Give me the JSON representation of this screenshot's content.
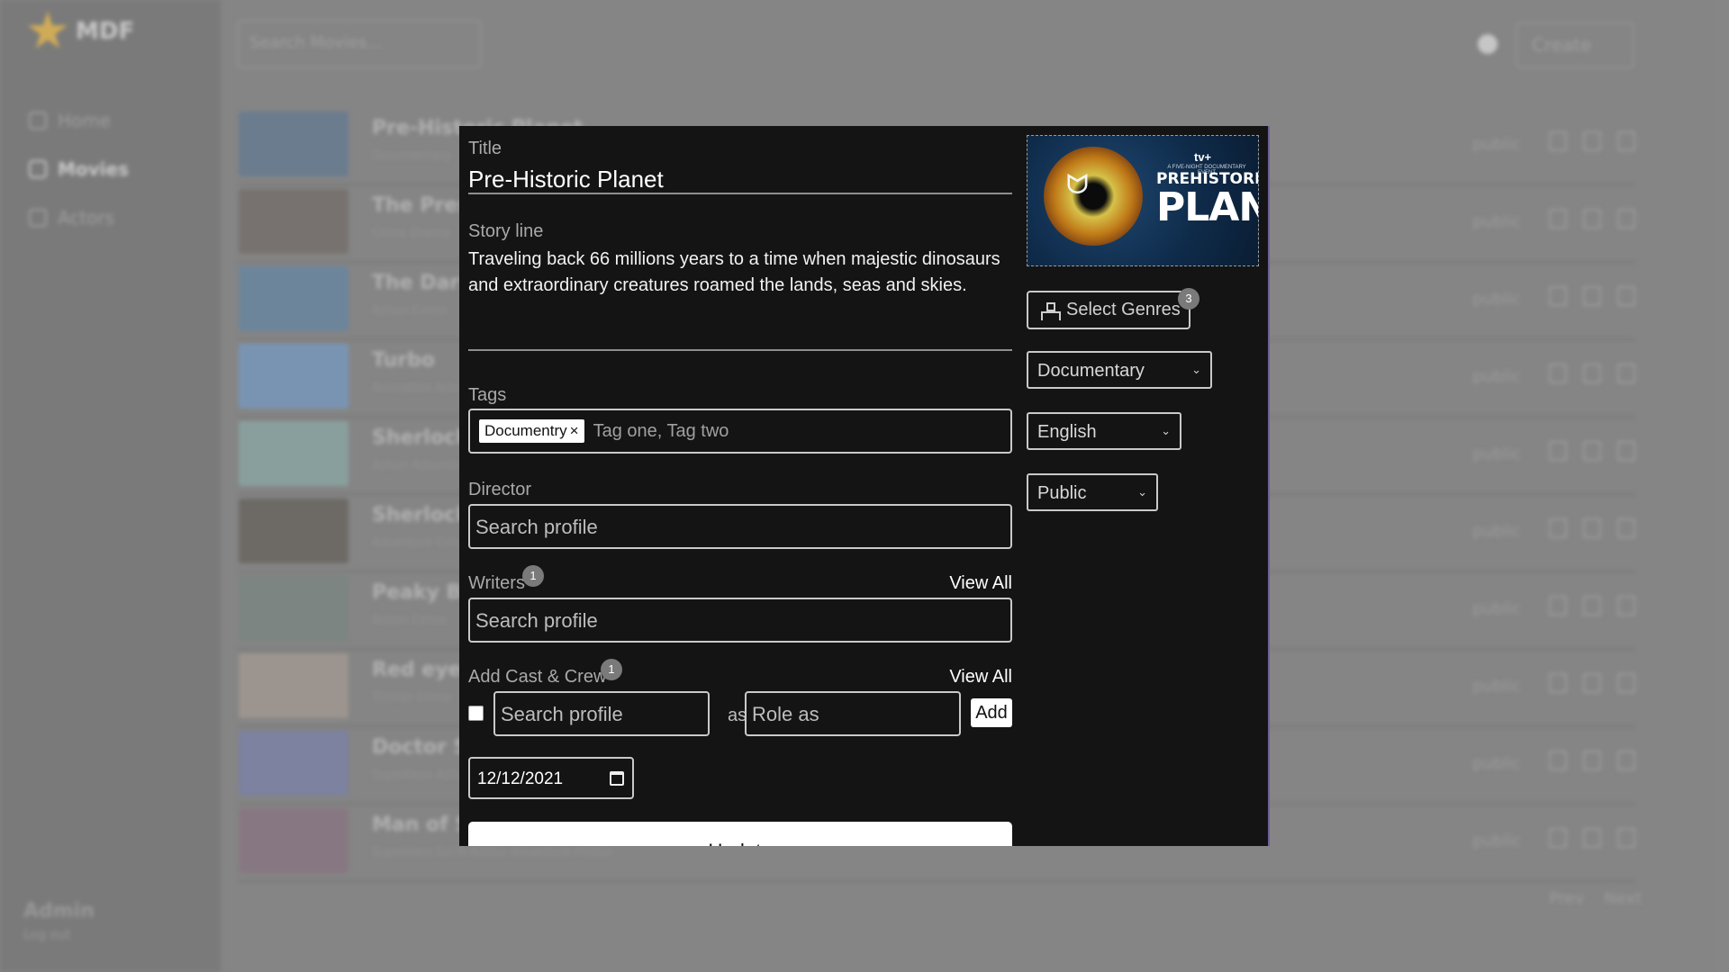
{
  "app": {
    "logo_text": "MDF",
    "search_placeholder": "Search Movies...",
    "create_label": "Create",
    "nav": [
      {
        "label": "Home",
        "icon": "home-icon"
      },
      {
        "label": "Movies",
        "icon": "film-icon"
      },
      {
        "label": "Actors",
        "icon": "user-icon"
      }
    ],
    "admin": {
      "name": "Admin",
      "logout": "Log out"
    },
    "movies": [
      {
        "title": "Pre-Historic Planet",
        "genres": "Documentary",
        "status": "public"
      },
      {
        "title": "The Prestige",
        "genres": "Crime Drama",
        "status": "public"
      },
      {
        "title": "The Dark Knight",
        "genres": "Action Crime",
        "status": "public"
      },
      {
        "title": "Turbo",
        "genres": "Animation Adventure",
        "status": "public"
      },
      {
        "title": "Sherlock Holmes",
        "genres": "Action Adventure",
        "status": "public"
      },
      {
        "title": "Sherlock",
        "genres": "Adventure Crime",
        "status": "public"
      },
      {
        "title": "Peaky Blinders",
        "genres": "Action Crime",
        "status": "public"
      },
      {
        "title": "Red eye",
        "genres": "Thriller Crime",
        "status": "public"
      },
      {
        "title": "Doctor Strange",
        "genres": "Superhero Action",
        "status": "public"
      },
      {
        "title": "Man of Steel",
        "genres": "Superhero Sci-Fi Action Adventure Fiction",
        "status": "public"
      }
    ],
    "pager": {
      "prev": "Prev",
      "next": "Next"
    }
  },
  "modal": {
    "title_label": "Title",
    "title_value": "Pre-Historic Planet",
    "story_label": "Story line",
    "story_value": "Traveling back 66 millions years to a time when majestic dinosaurs and extraordinary creatures roamed the lands, seas and skies.",
    "tags_label": "Tags",
    "tags": [
      "Documentry"
    ],
    "tag_remove": "×",
    "tags_placeholder": "Tag one, Tag two",
    "director_label": "Director",
    "director_placeholder": "Search profile",
    "writers_label": "Writers",
    "writers_count": "1",
    "writers_view_all": "View All",
    "writers_placeholder": "Search profile",
    "cast_label": "Add Cast & Crew",
    "cast_count": "1",
    "cast_view_all": "View All",
    "cast_placeholder": "Search profile",
    "cast_as": "as",
    "role_placeholder": "Role as",
    "add_label": "Add",
    "release_date": "12/12/2021",
    "update_label": "Update",
    "poster": {
      "brand": "tv+",
      "tagline": "A FIVE-NIGHT DOCUMENTARY EVENT",
      "line1": "PREHISTORIC",
      "line2": "PLANET"
    },
    "genres_label": "Select Genres",
    "genres_count": "3",
    "category_value": "Documentary",
    "language_value": "English",
    "status_value": "Public"
  }
}
